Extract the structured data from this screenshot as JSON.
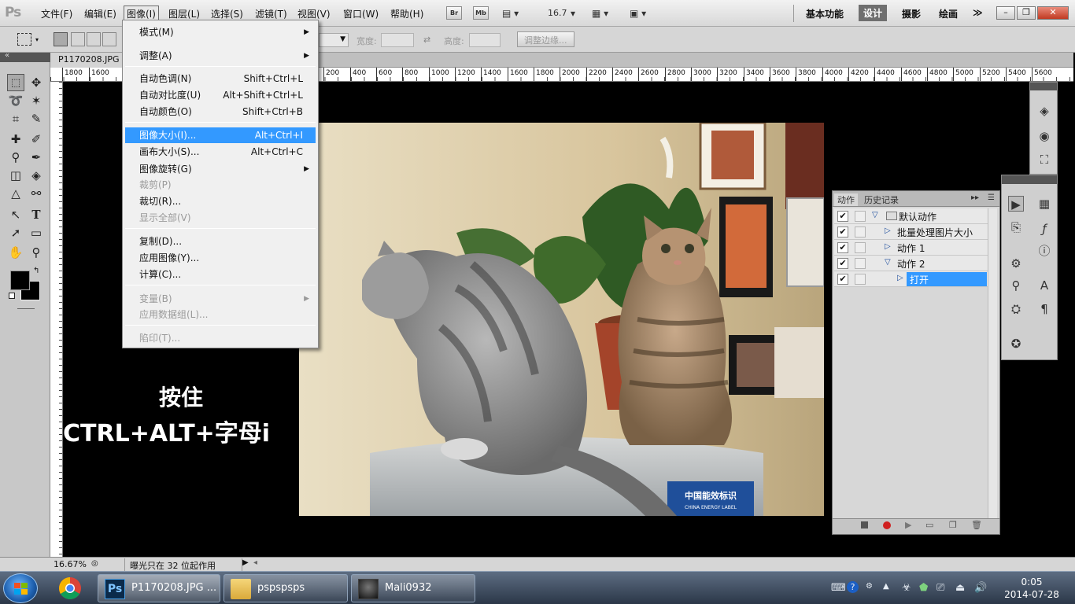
{
  "app": {
    "logo": "Ps"
  },
  "menubar": {
    "items": [
      "文件(F)",
      "编辑(E)",
      "图像(I)",
      "图层(L)",
      "选择(S)",
      "滤镜(T)",
      "视图(V)",
      "窗口(W)",
      "帮助(H)"
    ],
    "bridge_label": "Br",
    "minibridge_label": "Mb",
    "zoom_value": "16.7",
    "workspaces": [
      "基本功能",
      "设计",
      "摄影",
      "绘画"
    ],
    "more_symbol": "≫"
  },
  "options_bar": {
    "width_label": "宽度:",
    "height_label": "高度:",
    "refine_edge_label": "调整边缘..."
  },
  "document": {
    "tab_title": "P1170208.JPG",
    "ruler_ticks_h": [
      "1800",
      "1600",
      "200",
      "400",
      "600",
      "800",
      "1000",
      "1200",
      "1400",
      "1600",
      "1800",
      "2000",
      "2200",
      "2400",
      "2600",
      "2800",
      "3000",
      "3200",
      "3400",
      "3600",
      "3800",
      "4000",
      "4200",
      "4400",
      "4600",
      "4800",
      "5000",
      "5200",
      "5400",
      "5600"
    ],
    "overlay_line1": "按住",
    "overlay_line2": "CTRL+ALT+字母i",
    "photo_label_1": "中国能效标识",
    "photo_label_2": "CHINA ENERGY LABEL"
  },
  "image_menu": {
    "items": [
      {
        "label": "模式(M)",
        "shortcut": "",
        "submenu": true,
        "disabled": false
      },
      {
        "label": "调整(A)",
        "shortcut": "",
        "submenu": true,
        "disabled": false
      },
      {
        "label": "自动色调(N)",
        "shortcut": "Shift+Ctrl+L",
        "submenu": false,
        "disabled": false
      },
      {
        "label": "自动对比度(U)",
        "shortcut": "Alt+Shift+Ctrl+L",
        "submenu": false,
        "disabled": false
      },
      {
        "label": "自动颜色(O)",
        "shortcut": "Shift+Ctrl+B",
        "submenu": false,
        "disabled": false
      },
      {
        "label": "图像大小(I)...",
        "shortcut": "Alt+Ctrl+I",
        "submenu": false,
        "disabled": false,
        "highlighted": true
      },
      {
        "label": "画布大小(S)...",
        "shortcut": "Alt+Ctrl+C",
        "submenu": false,
        "disabled": false
      },
      {
        "label": "图像旋转(G)",
        "shortcut": "",
        "submenu": true,
        "disabled": false
      },
      {
        "label": "裁剪(P)",
        "shortcut": "",
        "submenu": false,
        "disabled": true
      },
      {
        "label": "裁切(R)...",
        "shortcut": "",
        "submenu": false,
        "disabled": false
      },
      {
        "label": "显示全部(V)",
        "shortcut": "",
        "submenu": false,
        "disabled": true
      },
      {
        "label": "复制(D)...",
        "shortcut": "",
        "submenu": false,
        "disabled": false
      },
      {
        "label": "应用图像(Y)...",
        "shortcut": "",
        "submenu": false,
        "disabled": false
      },
      {
        "label": "计算(C)...",
        "shortcut": "",
        "submenu": false,
        "disabled": false
      },
      {
        "label": "变量(B)",
        "shortcut": "",
        "submenu": true,
        "disabled": true
      },
      {
        "label": "应用数据组(L)...",
        "shortcut": "",
        "submenu": false,
        "disabled": true
      },
      {
        "label": "陷印(T)...",
        "shortcut": "",
        "submenu": false,
        "disabled": true
      }
    ]
  },
  "actions_panel": {
    "tabs": [
      "动作",
      "历史记录"
    ],
    "rows": [
      {
        "label": "默认动作",
        "checked": "✔"
      },
      {
        "label": "批量处理图片大小",
        "checked": "✔"
      },
      {
        "label": "动作 1",
        "checked": "✔"
      },
      {
        "label": "动作 2",
        "checked": "✔"
      },
      {
        "label": "打开",
        "checked": "✔"
      }
    ]
  },
  "status_bar": {
    "zoom": "16.67%",
    "info": "曝光只在 32 位起作用"
  },
  "taskbar": {
    "buttons": [
      {
        "label": "P1170208.JPG ..."
      },
      {
        "label": "pspspsps"
      },
      {
        "label": "Mali0932"
      }
    ],
    "clock_time": "0:05",
    "clock_date": "2014-07-28"
  },
  "colors": {
    "highlight": "#3399ff",
    "menubar_bg": "#dcdcdc",
    "panel_bg": "#d6d6d6",
    "canvas_bg": "#000000"
  }
}
